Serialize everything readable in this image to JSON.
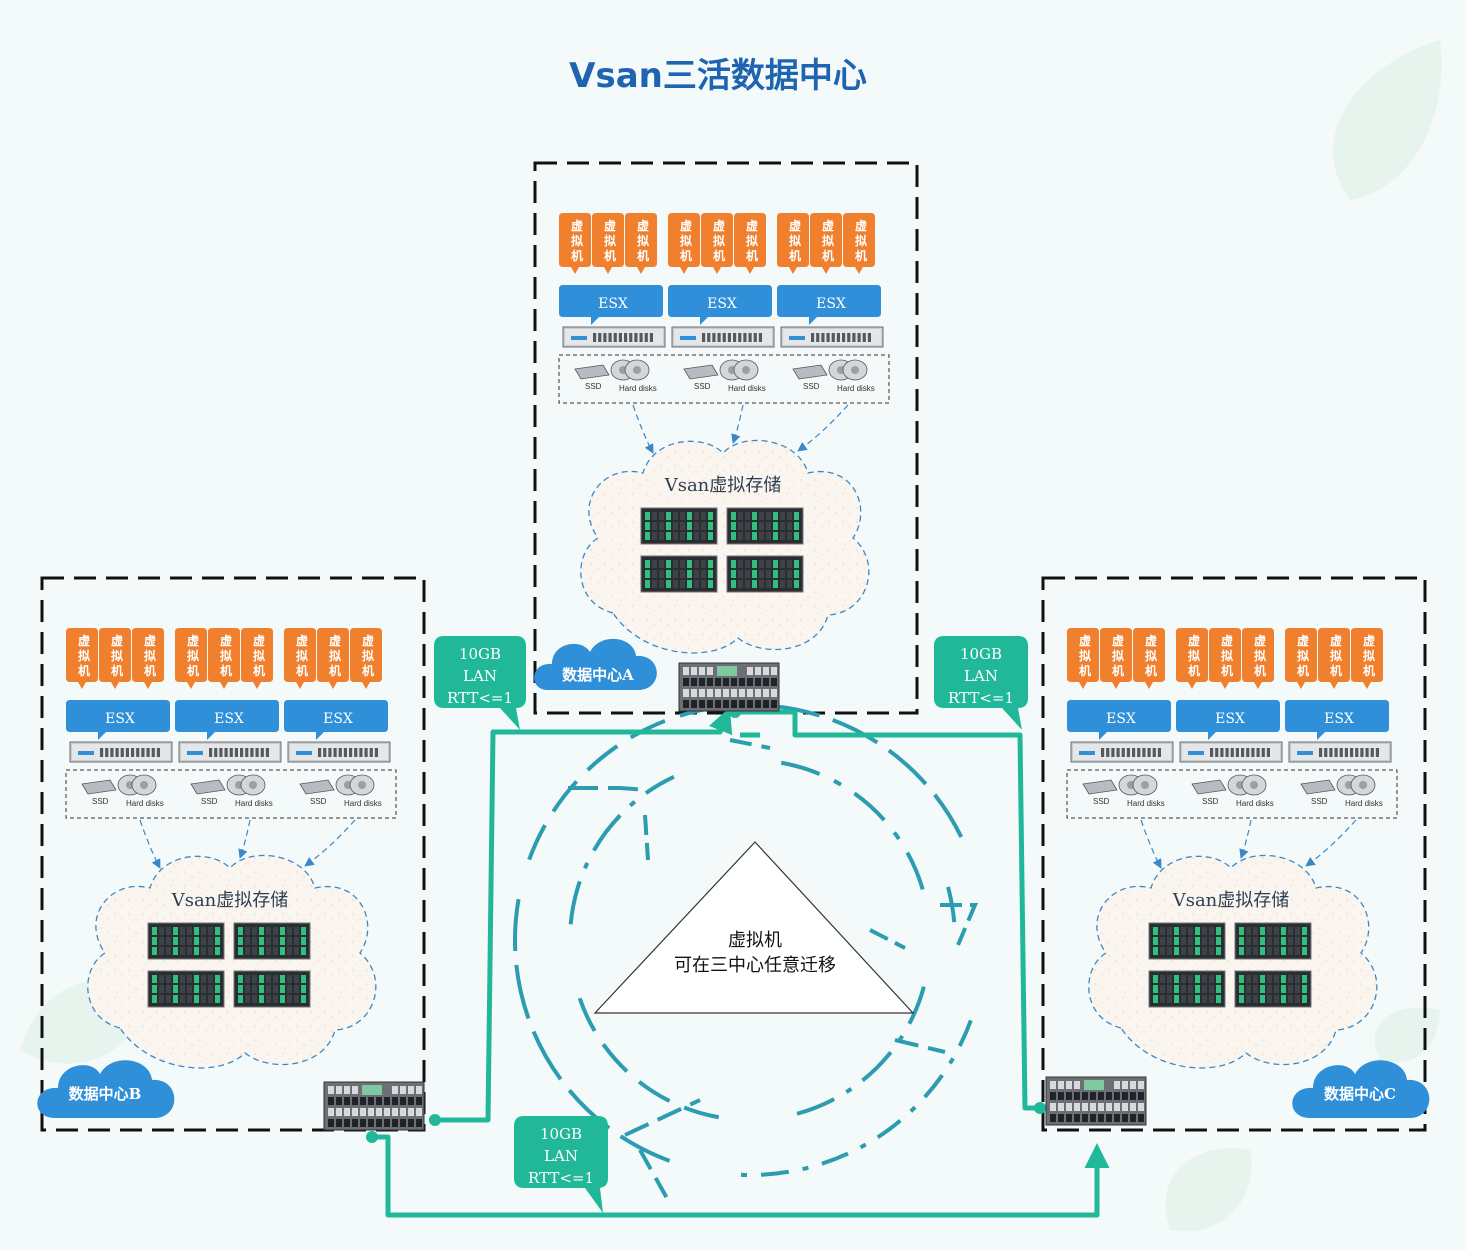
{
  "title": "Vsan三活数据中心",
  "vm_label": "虚\n拟\n机",
  "esx_label": "ESX",
  "ssd_label": "SSD",
  "hdd_label": "Hard disks",
  "storage_label": "Vsan虚拟存储",
  "datacenters": [
    {
      "id": "a",
      "label": "数据中心A"
    },
    {
      "id": "b",
      "label": "数据中心B"
    },
    {
      "id": "c",
      "label": "数据中心C"
    }
  ],
  "links": [
    {
      "id": "ab",
      "lines": [
        "10GB",
        "LAN",
        "RTT<=1"
      ]
    },
    {
      "id": "ac",
      "lines": [
        "10GB",
        "LAN",
        "RTT<=1"
      ]
    },
    {
      "id": "bc",
      "lines": [
        "10GB",
        "LAN",
        "RTT<=1"
      ]
    }
  ],
  "center": {
    "line1": "虚拟机",
    "line2": "可在三中心任意迁移"
  },
  "colors": {
    "title": "#1e64b0",
    "vm": "#f07f2e",
    "esx": "#2f8fd8",
    "link": "#21b89a",
    "cloud": "#2f8fd8",
    "arcs": "#2c9cb0",
    "frame": "#111111"
  }
}
